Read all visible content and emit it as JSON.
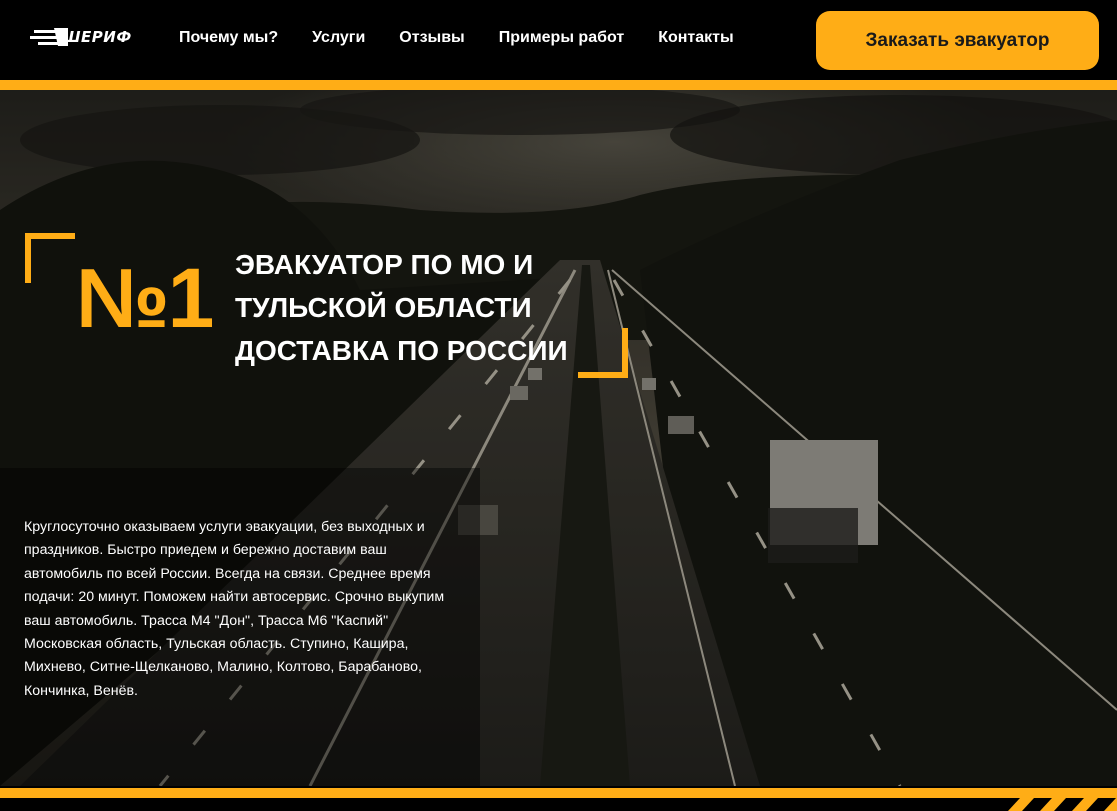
{
  "brand": {
    "name": "ШЕРИФ",
    "logo_icon": "speed-lines-icon"
  },
  "nav": {
    "items": [
      {
        "label": "Почему мы?"
      },
      {
        "label": "Услуги"
      },
      {
        "label": "Отзывы"
      },
      {
        "label": "Примеры работ"
      },
      {
        "label": "Контакты"
      }
    ],
    "cta_label": "Заказать эвакуатор"
  },
  "hero": {
    "number": "№1",
    "headline_lines": [
      "ЭВАКУАТОР ПО МО И",
      "ТУЛЬСКОЙ ОБЛАСТИ",
      "ДОСТАВКА ПО РОССИИ"
    ],
    "description": "Круглосуточно оказываем услуги эвакуации, без выходных и праздников. Быстро приедем и бережно доставим ваш автомобиль по всей России. Всегда на связи. Среднее время подачи: 20 минут. Поможем найти автосервис. Срочно выкупим ваш автомобиль. Трасса М4 \"Дон\", Трасса М6 \"Каспий\" Московская область, Тульская область. Ступино, Кашира, Михнево, Ситне-Щелканово, Малино, Колтово, Барабаново, Кончинка, Венёв.",
    "background_image": "highway-landscape"
  },
  "colors": {
    "accent": "#ffad16",
    "header_bg": "#000000",
    "text": "#ffffff"
  }
}
